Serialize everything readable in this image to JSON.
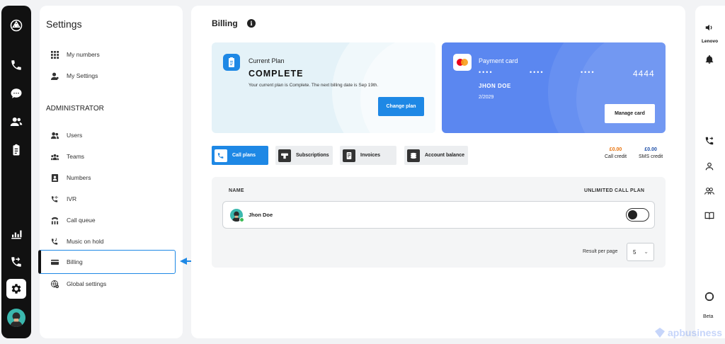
{
  "settings": {
    "title": "Settings",
    "top_items": [
      {
        "label": "My numbers",
        "icon": "grid-icon"
      },
      {
        "label": "My Settings",
        "icon": "person-icon"
      }
    ],
    "admin_label": "ADMINISTRATOR",
    "admin_items": [
      {
        "label": "Users",
        "icon": "users-icon"
      },
      {
        "label": "Teams",
        "icon": "team-icon"
      },
      {
        "label": "Numbers",
        "icon": "contact-card-icon"
      },
      {
        "label": "IVR",
        "icon": "ivr-icon"
      },
      {
        "label": "Call queue",
        "icon": "call-queue-icon"
      },
      {
        "label": "Music on hold",
        "icon": "music-phone-icon"
      },
      {
        "label": "Billing",
        "icon": "credit-card-icon"
      },
      {
        "label": "Global settings",
        "icon": "globe-settings-icon"
      }
    ]
  },
  "billing": {
    "title": "Billing",
    "info_glyph": "i",
    "plan": {
      "label": "Current Plan",
      "name": "COMPLETE",
      "description": "Your current plan is Complete. The next billing date is Sep 19th.",
      "button": "Change plan"
    },
    "payment": {
      "label": "Payment card",
      "masked_group": "••••",
      "last4": "4444",
      "holder": "JHON DOE",
      "expiry": "2/2029",
      "button": "Manage card"
    },
    "tabs": [
      {
        "label": "Call plans",
        "icon": "phone-icon",
        "active": true
      },
      {
        "label": "Subscriptions",
        "icon": "subscription-icon",
        "active": false
      },
      {
        "label": "Invoices",
        "icon": "invoice-icon",
        "active": false
      },
      {
        "label": "Account balance",
        "icon": "coins-icon",
        "active": false
      }
    ],
    "call_credit": {
      "amount": "£0.00",
      "label": "Call credit",
      "color": "#e8710a"
    },
    "sms_credit": {
      "amount": "£0.00",
      "label": "SMS credit",
      "color": "#1e4fa8"
    },
    "table": {
      "col_name": "NAME",
      "col_plan": "UNLIMITED CALL PLAN",
      "rows": [
        {
          "name": "Jhon Doe",
          "toggle_on": false
        }
      ],
      "results_label": "Result per page",
      "results_value": "5"
    }
  },
  "right_rail": {
    "lenovo": "Lenovo",
    "beta": "Beta"
  },
  "watermark": "apbusiness",
  "colors": {
    "accent": "#1e88e5",
    "payment_card": "#5b87f0",
    "plan_card": "#e4f2f8"
  }
}
